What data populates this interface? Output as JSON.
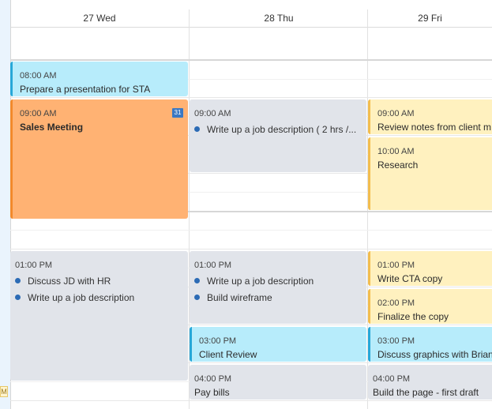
{
  "days": [
    {
      "label": "27 Wed"
    },
    {
      "label": "28 Thu"
    },
    {
      "label": "29 Fri"
    }
  ],
  "calendar_badge": "31",
  "left_tag": "M",
  "events": {
    "wed": {
      "presentation": {
        "time": "08:00 AM",
        "title": "Prepare a presentation for STA"
      },
      "sales": {
        "time": "09:00 AM",
        "title": "Sales Meeting"
      },
      "tasks_1pm": {
        "time": "01:00 PM",
        "items": [
          "Discuss JD with HR",
          "Write up a job description"
        ]
      }
    },
    "thu": {
      "job_desc": {
        "time": "09:00 AM",
        "item": "Write up a job description ( 2 hrs /..."
      },
      "tasks_1pm": {
        "time": "01:00 PM",
        "items": [
          "Write up a job description",
          "Build wireframe"
        ]
      },
      "client_review": {
        "time": "03:00 PM",
        "title": "Client Review"
      },
      "pay_bills": {
        "time": "04:00 PM",
        "title": "Pay bills"
      }
    },
    "fri": {
      "review_notes": {
        "time": "09:00 AM",
        "title": "Review notes from client m"
      },
      "research": {
        "time": "10:00 AM",
        "title": "Research"
      },
      "cta": {
        "time": "01:00 PM",
        "title": "Write CTA copy"
      },
      "finalize": {
        "time": "02:00 PM",
        "title": "Finalize the copy"
      },
      "graphics": {
        "time": "03:00 PM",
        "title": "Discuss graphics with Brian"
      },
      "build_page": {
        "time": "04:00 PM",
        "title": "Build the page - first draft"
      }
    }
  },
  "colors": {
    "blue": "#b7ecfb",
    "orange": "#ffb273",
    "gray": "#e1e4ea",
    "yellow": "#fff1bf",
    "task_dot": "#2c6bb5"
  }
}
